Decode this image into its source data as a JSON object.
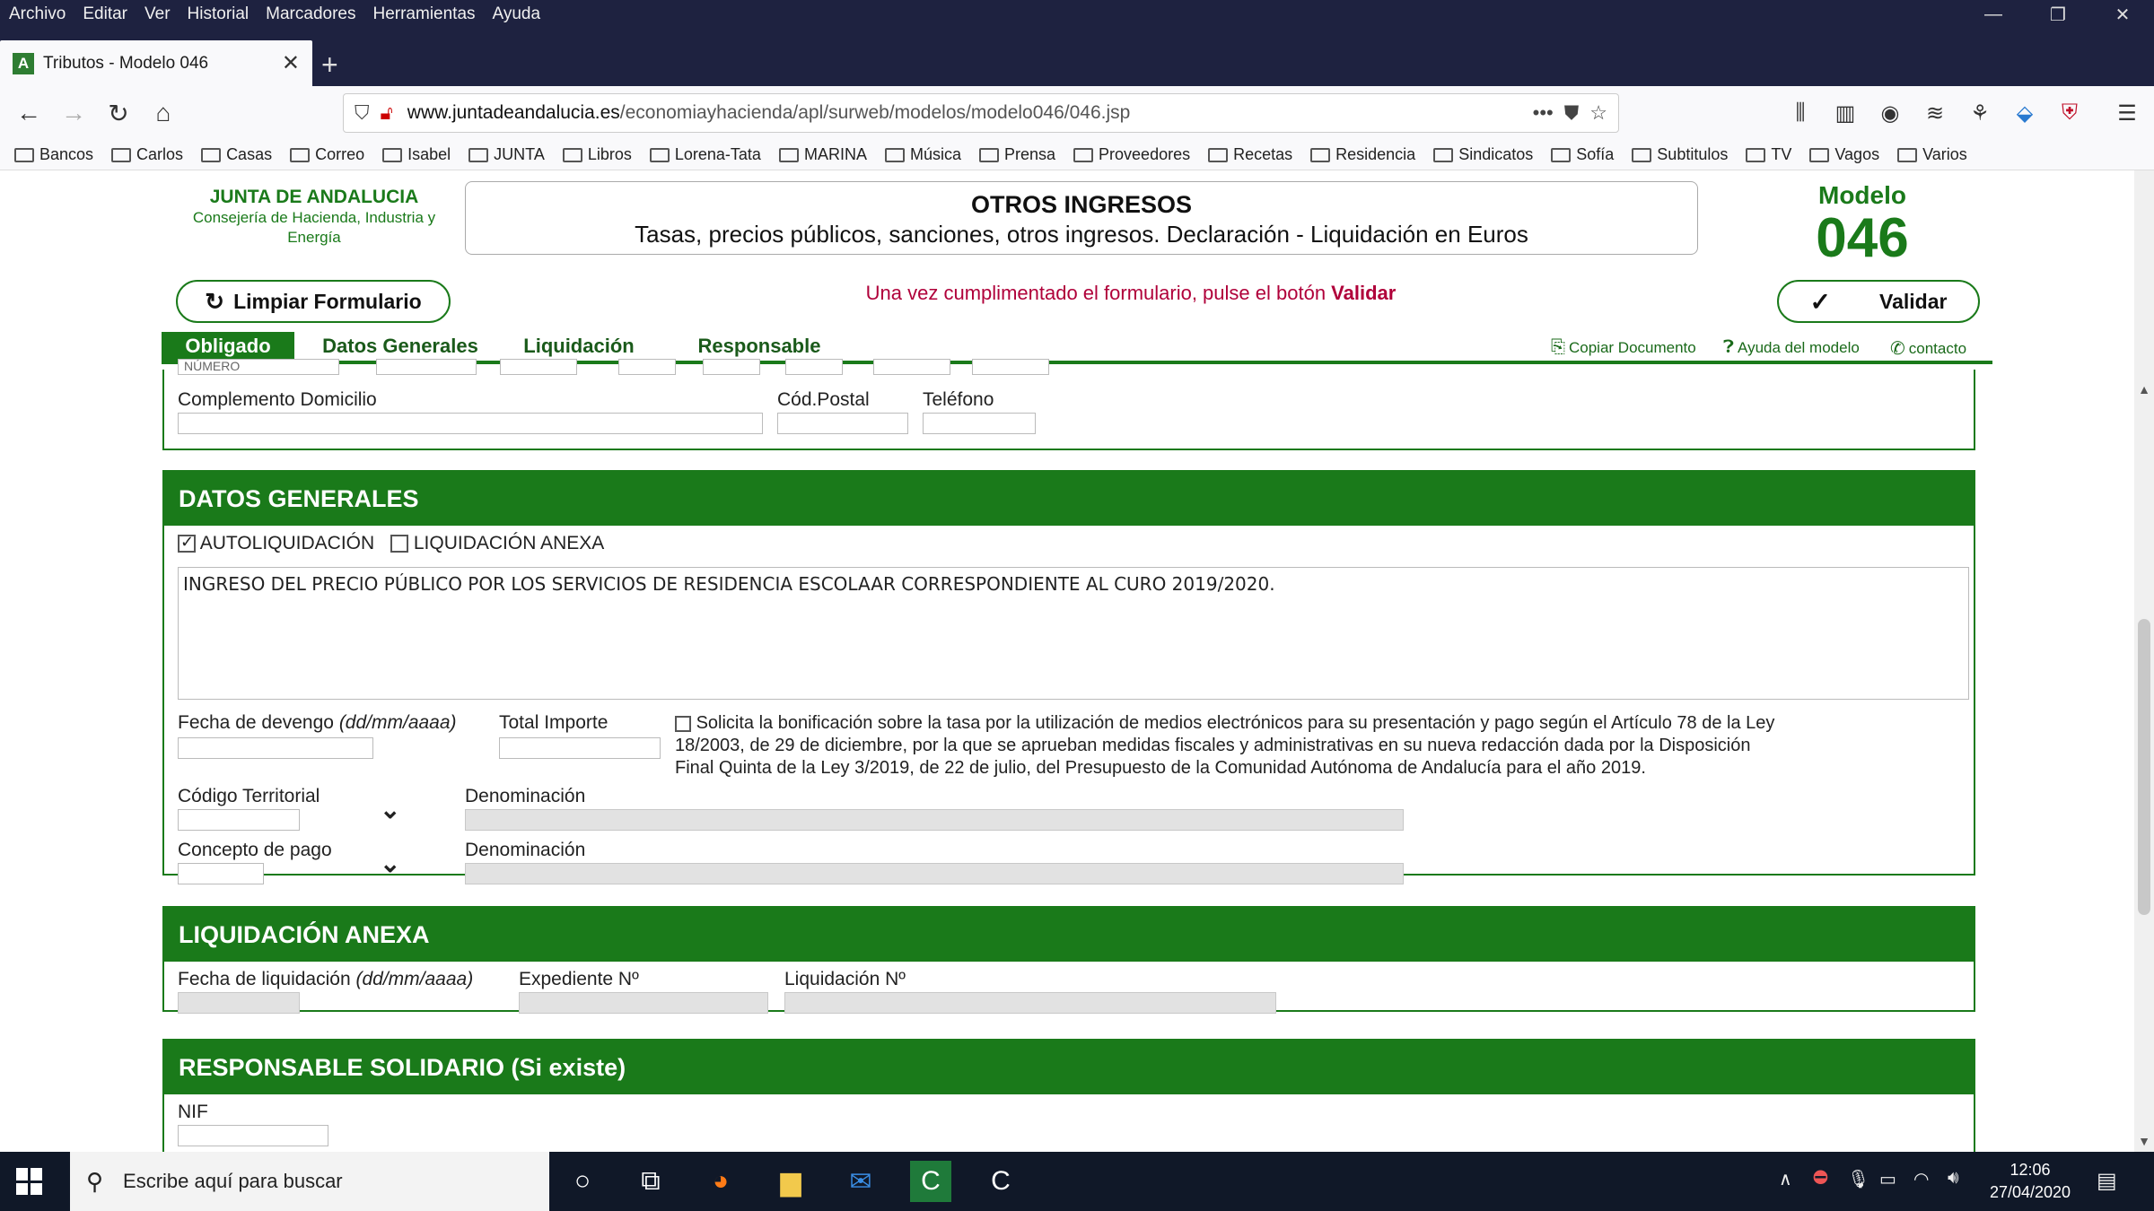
{
  "menubar": {
    "items": [
      "Archivo",
      "Editar",
      "Ver",
      "Historial",
      "Marcadores",
      "Herramientas",
      "Ayuda"
    ]
  },
  "tab": {
    "title": "Tributos - Modelo 046",
    "favicon": "A"
  },
  "url": {
    "domain": "www.juntadeandalucia.es",
    "path": "/economiayhacienda/apl/surweb/modelos/modelo046/046.jsp"
  },
  "bookmarks": [
    "Bancos",
    "Carlos",
    "Casas",
    "Correo",
    "Isabel",
    "JUNTA",
    "Libros",
    "Lorena-Tata",
    "MARINA",
    "Música",
    "Prensa",
    "Proveedores",
    "Recetas",
    "Residencia",
    "Sindicatos",
    "Sofía",
    "Subtitulos",
    "TV",
    "Vagos",
    "Varios"
  ],
  "header": {
    "org_name": "JUNTA DE ANDALUCIA",
    "org_sub1": "Consejería de Hacienda, Industria y",
    "org_sub2": "Energía",
    "title": "OTROS INGRESOS",
    "subtitle": "Tasas, precios públicos, sanciones, otros ingresos. Declaración - Liquidación en Euros",
    "modelo_label": "Modelo",
    "modelo_num": "046"
  },
  "actions": {
    "clear": "Limpiar Formulario",
    "notice": "Una vez cumplimentado el formulario, pulse el botón ",
    "notice_bold": "Validar",
    "validate": "Validar"
  },
  "page_tabs": [
    "Obligado",
    "Datos Generales",
    "Liquidación",
    "Responsable"
  ],
  "tools": {
    "copy": "Copiar Documento",
    "help": "Ayuda del modelo",
    "contact": "contacto"
  },
  "obligado": {
    "numero_label": "NÚMERO",
    "complemento_label": "Complemento Domicilio",
    "cp_label": "Cód.Postal",
    "telefono_label": "Teléfono"
  },
  "datos_generales": {
    "heading": "DATOS GENERALES",
    "autoliq_label": "AUTOLIQUIDACIÓN",
    "liqanexa_label": "LIQUIDACIÓN ANEXA",
    "autoliq_checked": true,
    "liqanexa_checked": false,
    "descripcion": "INGRESO DEL PRECIO PÚBLICO POR LOS SERVICIOS DE RESIDENCIA ESCOLAAR CORRESPONDIENTE AL CURO 2019/2020.",
    "fecha_label": "Fecha de devengo ",
    "fecha_fmt": "(dd/mm/aaaa)",
    "importe_label": "Total Importe",
    "bonif_line1": "Solicita la bonificación sobre la tasa por la utilización de medios electrónicos para su presentación y pago según el Artículo 78 de la Ley",
    "bonif_line2": "18/2003, de 29 de diciembre, por la que se aprueban medidas fiscales y administrativas en su nueva redacción dada por la Disposición",
    "bonif_line3": "Final Quinta de la Ley 3/2019, de 22 de julio, del Presupuesto de la Comunidad Autónoma de Andalucía para el año 2019.",
    "codigo_label": "Código Territorial",
    "denominacion_label": "Denominación",
    "concepto_label": "Concepto de pago"
  },
  "liq_anexa": {
    "heading": "LIQUIDACIÓN ANEXA",
    "fecha_label": "Fecha de liquidación ",
    "fecha_fmt": "(dd/mm/aaaa)",
    "expediente_label": "Expediente Nº",
    "liquidacion_label": "Liquidación Nº"
  },
  "responsable": {
    "heading": "RESPONSABLE SOLIDARIO (Si existe)",
    "nif_label": "NIF"
  },
  "taskbar": {
    "search_placeholder": "Escribe aquí para buscar",
    "time": "12:06",
    "date": "27/04/2020"
  },
  "colors": {
    "green": "#1a7a1a",
    "notice": "#b0003a",
    "chrome": "#1e2240"
  }
}
